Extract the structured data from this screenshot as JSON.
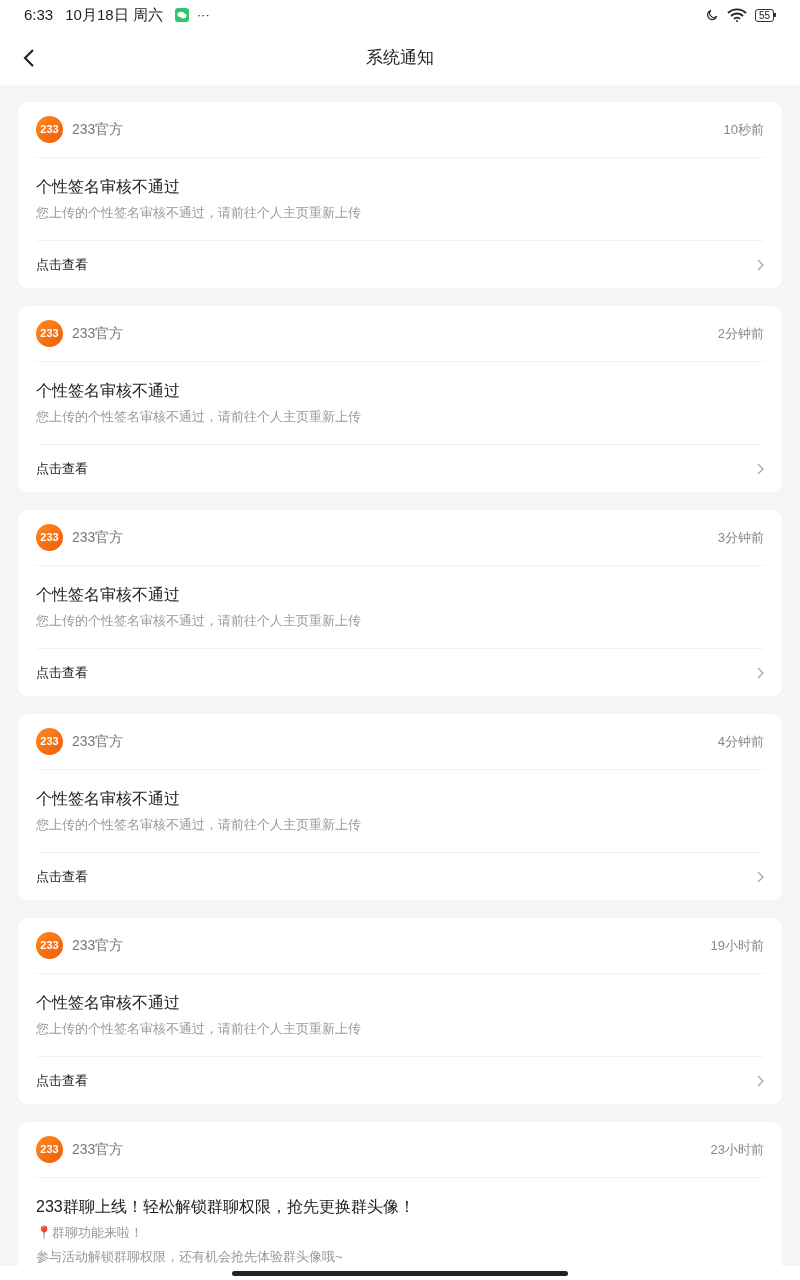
{
  "status_bar": {
    "time": "6:33",
    "date": "10月18日 周六",
    "more": "···",
    "battery": "55"
  },
  "header": {
    "title": "系统通知"
  },
  "notifications": [
    {
      "sender": "233官方",
      "avatar_text": "233",
      "time": "10秒前",
      "title": "个性签名审核不通过",
      "body": [
        "您上传的个性签名审核不通过，请前往个人主页重新上传"
      ],
      "action": "点击查看"
    },
    {
      "sender": "233官方",
      "avatar_text": "233",
      "time": "2分钟前",
      "title": "个性签名审核不通过",
      "body": [
        "您上传的个性签名审核不通过，请前往个人主页重新上传"
      ],
      "action": "点击查看"
    },
    {
      "sender": "233官方",
      "avatar_text": "233",
      "time": "3分钟前",
      "title": "个性签名审核不通过",
      "body": [
        "您上传的个性签名审核不通过，请前往个人主页重新上传"
      ],
      "action": "点击查看"
    },
    {
      "sender": "233官方",
      "avatar_text": "233",
      "time": "4分钟前",
      "title": "个性签名审核不通过",
      "body": [
        "您上传的个性签名审核不通过，请前往个人主页重新上传"
      ],
      "action": "点击查看"
    },
    {
      "sender": "233官方",
      "avatar_text": "233",
      "time": "19小时前",
      "title": "个性签名审核不通过",
      "body": [
        "您上传的个性签名审核不通过，请前往个人主页重新上传"
      ],
      "action": "点击查看"
    },
    {
      "sender": "233官方",
      "avatar_text": "233",
      "time": "23小时前",
      "title": "233群聊上线！轻松解锁群聊权限，抢先更换群头像！",
      "body": [
        "📍群聊功能来啦！",
        "参与活动解锁群聊权限，还有机会抢先体验群头像哦~"
      ]
    }
  ]
}
